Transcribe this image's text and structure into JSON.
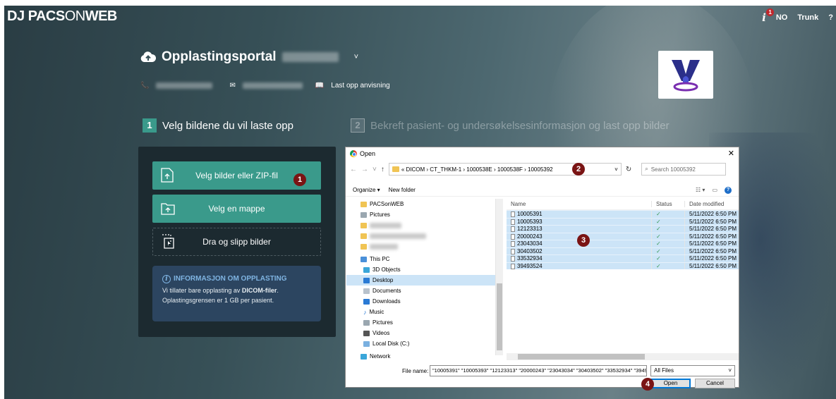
{
  "header": {
    "brand_bold": "DJ PACS",
    "brand_thin": "ON",
    "brand_end": "WEB",
    "info_badge": "1",
    "language": "NO",
    "user": "Trunk",
    "help": "?"
  },
  "portal": {
    "title": "Opplastingsportal",
    "dropdown": "˅",
    "upload_guide": "Last opp anvisning"
  },
  "steps": [
    {
      "num": "1",
      "label": "Velg bildene du vil laste opp"
    },
    {
      "num": "2",
      "label": "Bekreft pasient- og undersøkelsesinformasjon og last opp bilder"
    }
  ],
  "upload": {
    "zip_button": "Velg bilder eller ZIP-fil",
    "folder_button": "Velg en mappe",
    "drop_zone": "Dra og slipp bilder",
    "info_title": "INFORMASJON OM OPPLASTING",
    "info_line1_pre": "Vi tillater bare opplasting av ",
    "info_line1_bold": "DICOM-filer",
    "info_line1_post": ".",
    "info_line2": "Oplastingsgrensen er 1 GB per pasient."
  },
  "callouts": [
    "1",
    "2",
    "3",
    "4"
  ],
  "dialog": {
    "title": "Open",
    "close": "✕",
    "path": "« DICOM › CT_THKM-1 › 1000538E › 1000538F › 10005392",
    "search_placeholder": "Search 10005392",
    "organize": "Organize ▾",
    "new_folder": "New folder",
    "nav_items": [
      {
        "label": "PACSonWEB",
        "icon": "folder-icon"
      },
      {
        "label": "Pictures",
        "icon": "pictures-icon"
      },
      {
        "label": "",
        "icon": "folder-icon"
      },
      {
        "label": "",
        "icon": "folder-icon"
      },
      {
        "label": "",
        "icon": "folder-icon"
      },
      {
        "label": "This PC",
        "icon": "pc-icon"
      },
      {
        "label": "3D Objects",
        "icon": "3d-objects-icon"
      },
      {
        "label": "Desktop",
        "icon": "desktop-icon"
      },
      {
        "label": "Documents",
        "icon": "documents-icon"
      },
      {
        "label": "Downloads",
        "icon": "downloads-icon"
      },
      {
        "label": "Music",
        "icon": "music-icon"
      },
      {
        "label": "Pictures",
        "icon": "pictures-icon"
      },
      {
        "label": "Videos",
        "icon": "videos-icon"
      },
      {
        "label": "Local Disk (C:)",
        "icon": "disk-icon"
      },
      {
        "label": "Network",
        "icon": "network-icon"
      }
    ],
    "columns": {
      "name": "Name",
      "status": "Status",
      "date": "Date modified"
    },
    "files": [
      {
        "name": "10005391",
        "status": "✓",
        "date": "5/11/2022 6:50 PM"
      },
      {
        "name": "10005393",
        "status": "✓",
        "date": "5/11/2022 6:50 PM"
      },
      {
        "name": "12123313",
        "status": "✓",
        "date": "5/11/2022 6:50 PM"
      },
      {
        "name": "20000243",
        "status": "✓",
        "date": "5/11/2022 6:50 PM"
      },
      {
        "name": "23043034",
        "status": "✓",
        "date": "5/11/2022 6:50 PM"
      },
      {
        "name": "30403502",
        "status": "✓",
        "date": "5/11/2022 6:50 PM"
      },
      {
        "name": "33532934",
        "status": "✓",
        "date": "5/11/2022 6:50 PM"
      },
      {
        "name": "39493524",
        "status": "✓",
        "date": "5/11/2022 6:50 PM"
      }
    ],
    "file_name_label": "File name:",
    "file_name_value": "\"10005391\" \"10005393\" \"12123313\" \"20000243\" \"23043034\" \"30403502\" \"33532934\" \"394935",
    "file_type": "All Files",
    "open_button": "Open",
    "cancel_button": "Cancel"
  },
  "colors": {
    "accent": "#3a9a8b",
    "panel": "#1c2a30",
    "info_box": "#2c4560",
    "callout": "#7a1414"
  }
}
